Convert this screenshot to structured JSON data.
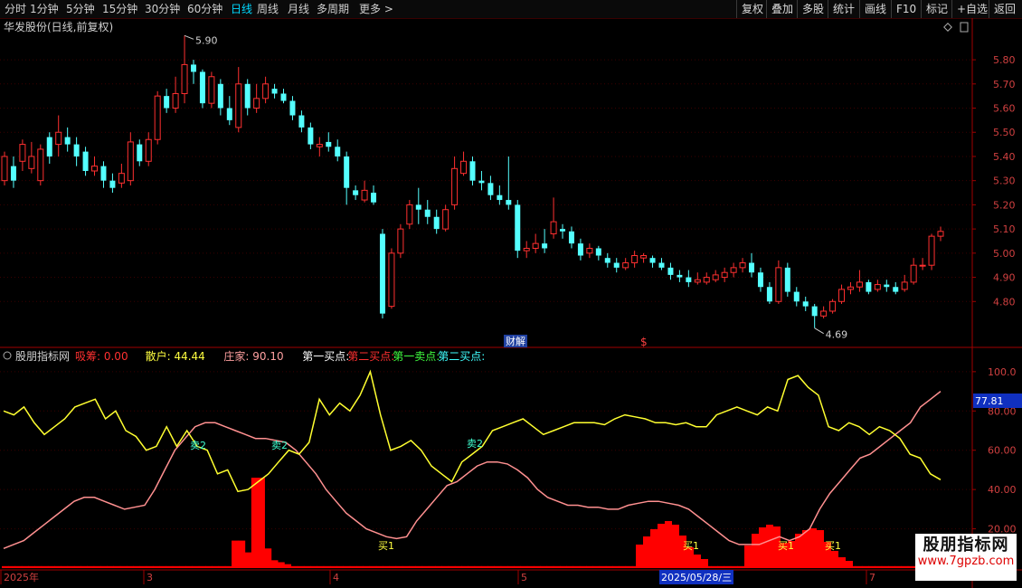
{
  "toolbar": {
    "timeframes": [
      {
        "label": "分时",
        "x": 5
      },
      {
        "label": "1分钟",
        "x": 33
      },
      {
        "label": "5分钟",
        "x": 73
      },
      {
        "label": "15分钟",
        "x": 113
      },
      {
        "label": "30分钟",
        "x": 160
      },
      {
        "label": "60分钟",
        "x": 207
      },
      {
        "label": "日线",
        "x": 255,
        "active": true
      },
      {
        "label": "周线",
        "x": 284
      },
      {
        "label": "月线",
        "x": 318
      },
      {
        "label": "多周期",
        "x": 350
      },
      {
        "label": "更多",
        "x": 397
      }
    ],
    "more_arrow": ">",
    "right_buttons": [
      {
        "label": "复权",
        "x": 814
      },
      {
        "label": "叠加",
        "x": 847
      },
      {
        "label": "多股",
        "x": 881
      },
      {
        "label": "统计",
        "x": 915
      },
      {
        "label": "画线",
        "x": 950
      },
      {
        "label": "F10",
        "x": 985
      },
      {
        "label": "标记",
        "x": 1018
      },
      {
        "label": "+自选",
        "x": 1052
      },
      {
        "label": "返回",
        "x": 1093
      }
    ]
  },
  "main_panel": {
    "title": "华发股份(日线,前复权)",
    "high_label": "5.90",
    "low_label": "4.69",
    "markers": {
      "caijie": "财解",
      "dollar": "$"
    },
    "y_ticks": [
      "5.80",
      "5.70",
      "5.60",
      "5.50",
      "5.40",
      "5.30",
      "5.20",
      "5.10",
      "5.00",
      "4.90",
      "4.80"
    ]
  },
  "indicator_panel": {
    "name": "股朋指标网",
    "legend": [
      {
        "label": "吸筹:",
        "value": "0.00",
        "color": "#ff3030"
      },
      {
        "label": "散户:",
        "value": "44.44",
        "color": "#ffff40"
      },
      {
        "label": "庄家:",
        "value": "90.10",
        "color": "#ffa0a0"
      },
      {
        "label": "第一买点:",
        "value": "",
        "color": "#ffffff"
      },
      {
        "label": "第二买点:",
        "value": "",
        "color": "#ff3030"
      },
      {
        "label": "第一卖点:",
        "value": "",
        "color": "#40ff40"
      },
      {
        "label": "第二买点:",
        "value": "",
        "color": "#40ffff"
      }
    ],
    "y_ticks": [
      "100.0",
      "80.00",
      "60.00",
      "40.00",
      "20.00"
    ],
    "current_value": "77.81",
    "sell_labels": [
      "卖2",
      "卖2",
      "卖2"
    ],
    "buy_labels": [
      "买1",
      "买1",
      "买1",
      "买1"
    ]
  },
  "x_axis": {
    "labels": [
      "2025年",
      "3",
      "4",
      "5",
      "2025/05/28/三",
      "7"
    ]
  },
  "watermark": {
    "title": "股朋指标网",
    "url": "www.7gpzb.com"
  },
  "colors": {
    "up": "#ff3030",
    "down": "#54ffff",
    "retail": "#ffff30",
    "banker": "#ff9090",
    "accum": "#ff0000"
  },
  "chart_data": [
    {
      "type": "candlestick",
      "title": "华发股份(日线,前复权)",
      "x": "trading days 2025-02 to 2025-07",
      "candles": [
        [
          5.3,
          5.4,
          5.42,
          5.28
        ],
        [
          5.36,
          5.3,
          5.4,
          5.27
        ],
        [
          5.38,
          5.45,
          5.47,
          5.34
        ],
        [
          5.35,
          5.4,
          5.46,
          5.33
        ],
        [
          5.3,
          5.43,
          5.45,
          5.28
        ],
        [
          5.48,
          5.4,
          5.5,
          5.37
        ],
        [
          5.45,
          5.5,
          5.57,
          5.4
        ],
        [
          5.48,
          5.45,
          5.52,
          5.42
        ],
        [
          5.45,
          5.4,
          5.48,
          5.36
        ],
        [
          5.42,
          5.34,
          5.44,
          5.32
        ],
        [
          5.34,
          5.36,
          5.4,
          5.32
        ],
        [
          5.36,
          5.3,
          5.38,
          5.27
        ],
        [
          5.3,
          5.27,
          5.33,
          5.25
        ],
        [
          5.29,
          5.33,
          5.37,
          5.27
        ],
        [
          5.3,
          5.46,
          5.5,
          5.28
        ],
        [
          5.45,
          5.38,
          5.47,
          5.36
        ],
        [
          5.38,
          5.47,
          5.5,
          5.36
        ],
        [
          5.47,
          5.65,
          5.67,
          5.45
        ],
        [
          5.65,
          5.6,
          5.68,
          5.58
        ],
        [
          5.6,
          5.66,
          5.73,
          5.58
        ],
        [
          5.66,
          5.78,
          5.9,
          5.62
        ],
        [
          5.78,
          5.75,
          5.8,
          5.7
        ],
        [
          5.75,
          5.62,
          5.76,
          5.6
        ],
        [
          5.62,
          5.73,
          5.75,
          5.6
        ],
        [
          5.7,
          5.6,
          5.72,
          5.57
        ],
        [
          5.6,
          5.55,
          5.65,
          5.53
        ],
        [
          5.52,
          5.7,
          5.77,
          5.5
        ],
        [
          5.7,
          5.6,
          5.72,
          5.57
        ],
        [
          5.6,
          5.64,
          5.7,
          5.58
        ],
        [
          5.64,
          5.7,
          5.73,
          5.62
        ],
        [
          5.68,
          5.66,
          5.7,
          5.64
        ],
        [
          5.66,
          5.63,
          5.68,
          5.62
        ],
        [
          5.63,
          5.57,
          5.65,
          5.55
        ],
        [
          5.57,
          5.52,
          5.59,
          5.5
        ],
        [
          5.52,
          5.45,
          5.54,
          5.43
        ],
        [
          5.44,
          5.45,
          5.48,
          5.4
        ],
        [
          5.46,
          5.44,
          5.5,
          5.42
        ],
        [
          5.44,
          5.4,
          5.47,
          5.38
        ],
        [
          5.4,
          5.27,
          5.42,
          5.2
        ],
        [
          5.26,
          5.24,
          5.28,
          5.22
        ],
        [
          5.22,
          5.26,
          5.3,
          5.21
        ],
        [
          5.25,
          5.21,
          5.28,
          5.2
        ],
        [
          5.08,
          4.75,
          5.1,
          4.73
        ],
        [
          4.78,
          5.0,
          5.02,
          4.77
        ],
        [
          5.0,
          5.1,
          5.12,
          4.98
        ],
        [
          5.12,
          5.2,
          5.22,
          5.1
        ],
        [
          5.2,
          5.18,
          5.27,
          5.12
        ],
        [
          5.18,
          5.15,
          5.22,
          5.12
        ],
        [
          5.15,
          5.1,
          5.18,
          5.08
        ],
        [
          5.1,
          5.18,
          5.2,
          5.09
        ],
        [
          5.2,
          5.35,
          5.4,
          5.18
        ],
        [
          5.33,
          5.38,
          5.42,
          5.32
        ],
        [
          5.38,
          5.3,
          5.4,
          5.28
        ],
        [
          5.3,
          5.29,
          5.34,
          5.26
        ],
        [
          5.29,
          5.24,
          5.32,
          5.22
        ],
        [
          5.24,
          5.22,
          5.28,
          5.2
        ],
        [
          5.22,
          5.2,
          5.4,
          5.18
        ],
        [
          5.2,
          5.01,
          5.22,
          4.98
        ],
        [
          5.01,
          5.02,
          5.05,
          4.98
        ],
        [
          5.02,
          5.04,
          5.08,
          5.0
        ],
        [
          5.04,
          5.02,
          5.1,
          5.0
        ],
        [
          5.08,
          5.13,
          5.23,
          5.06
        ],
        [
          5.1,
          5.09,
          5.12,
          5.06
        ],
        [
          5.09,
          5.04,
          5.11,
          5.02
        ],
        [
          5.04,
          4.99,
          5.06,
          4.97
        ],
        [
          5.0,
          5.02,
          5.04,
          4.98
        ],
        [
          5.02,
          4.99,
          5.03,
          4.97
        ],
        [
          4.98,
          4.96,
          5.0,
          4.94
        ],
        [
          4.96,
          4.94,
          4.98,
          4.92
        ],
        [
          4.94,
          4.96,
          4.98,
          4.93
        ],
        [
          4.96,
          4.99,
          5.01,
          4.94
        ],
        [
          4.98,
          4.99,
          5.0,
          4.96
        ],
        [
          4.98,
          4.96,
          4.99,
          4.94
        ],
        [
          4.96,
          4.94,
          4.98,
          4.93
        ],
        [
          4.94,
          4.91,
          4.96,
          4.89
        ],
        [
          4.91,
          4.9,
          4.93,
          4.88
        ],
        [
          4.9,
          4.88,
          4.93,
          4.86
        ],
        [
          4.88,
          4.89,
          4.92,
          4.87
        ],
        [
          4.88,
          4.9,
          4.92,
          4.87
        ],
        [
          4.89,
          4.91,
          4.93,
          4.88
        ],
        [
          4.9,
          4.92,
          4.94,
          4.88
        ],
        [
          4.92,
          4.94,
          4.96,
          4.9
        ],
        [
          4.94,
          4.96,
          4.98,
          4.92
        ],
        [
          4.96,
          4.92,
          5.0,
          4.9
        ],
        [
          4.92,
          4.86,
          4.94,
          4.84
        ],
        [
          4.86,
          4.8,
          4.88,
          4.79
        ],
        [
          4.8,
          4.94,
          4.97,
          4.79
        ],
        [
          4.94,
          4.84,
          4.96,
          4.82
        ],
        [
          4.84,
          4.8,
          4.86,
          4.78
        ],
        [
          4.8,
          4.78,
          4.82,
          4.76
        ],
        [
          4.78,
          4.74,
          4.79,
          4.69
        ],
        [
          4.74,
          4.76,
          4.78,
          4.73
        ],
        [
          4.76,
          4.8,
          4.81,
          4.75
        ],
        [
          4.8,
          4.85,
          4.87,
          4.79
        ],
        [
          4.85,
          4.86,
          4.88,
          4.83
        ],
        [
          4.86,
          4.88,
          4.93,
          4.84
        ],
        [
          4.88,
          4.84,
          4.89,
          4.83
        ],
        [
          4.85,
          4.87,
          4.89,
          4.84
        ],
        [
          4.87,
          4.86,
          4.89,
          4.84
        ],
        [
          4.86,
          4.84,
          4.88,
          4.83
        ],
        [
          4.85,
          4.88,
          4.91,
          4.84
        ],
        [
          4.88,
          4.95,
          4.98,
          4.87
        ],
        [
          4.95,
          4.95,
          4.98,
          4.93
        ],
        [
          4.95,
          5.07,
          5.08,
          4.93
        ],
        [
          5.07,
          5.09,
          5.11,
          5.05
        ]
      ],
      "ylim": [
        4.7,
        5.92
      ]
    },
    {
      "type": "line+bar",
      "series": [
        {
          "name": "散户",
          "values": [
            80,
            78,
            82,
            74,
            68,
            72,
            76,
            82,
            84,
            86,
            76,
            80,
            70,
            67,
            60,
            62,
            72,
            62,
            70,
            62,
            60,
            48,
            50,
            39,
            40,
            44,
            48,
            54,
            60,
            58,
            64,
            86,
            78,
            84,
            80,
            88,
            100,
            78,
            60,
            62,
            65,
            60,
            52,
            48,
            44,
            54,
            58,
            62,
            70,
            72,
            74,
            76,
            72,
            68,
            70,
            72,
            74,
            74,
            74,
            73,
            76,
            78,
            77,
            76,
            74,
            74,
            73,
            74,
            72,
            72,
            78,
            80,
            82,
            80,
            78,
            82,
            80,
            96,
            98,
            92,
            88,
            72,
            70,
            74,
            72,
            68,
            72,
            70,
            66,
            58,
            56,
            48,
            45
          ]
        },
        {
          "name": "庄家",
          "values": [
            10,
            12,
            14,
            18,
            22,
            26,
            30,
            34,
            36,
            36,
            34,
            32,
            30,
            31,
            32,
            40,
            50,
            60,
            66,
            72,
            74,
            74,
            72,
            70,
            68,
            66,
            66,
            65,
            64,
            60,
            54,
            48,
            40,
            34,
            28,
            24,
            20,
            18,
            16,
            15,
            16,
            24,
            30,
            36,
            42,
            44,
            48,
            52,
            54,
            54,
            53,
            50,
            46,
            40,
            36,
            34,
            32,
            32,
            31,
            31,
            30,
            30,
            32,
            33,
            34,
            34,
            33,
            32,
            30,
            26,
            22,
            18,
            14,
            12,
            12,
            12,
            14,
            16,
            14,
            16,
            20,
            30,
            38,
            44,
            50,
            56,
            58,
            62,
            66,
            70,
            74,
            82,
            86,
            90
          ]
        },
        {
          "name": "吸筹",
          "values": [
            1,
            1,
            1,
            1,
            1,
            1,
            1,
            1,
            1,
            1,
            1,
            1,
            1,
            1,
            1,
            1,
            1,
            1,
            1,
            1,
            1,
            1,
            1,
            1,
            1,
            1,
            1,
            1,
            1,
            1,
            1,
            1,
            1,
            1,
            1,
            14,
            14,
            8,
            46,
            46,
            10,
            4,
            3,
            2,
            1,
            1,
            1,
            1,
            1,
            1,
            1,
            1,
            1,
            1,
            1,
            1,
            1,
            1,
            1,
            1,
            1,
            1,
            1,
            1,
            1,
            1,
            1,
            1,
            1,
            1,
            1,
            1,
            1,
            1,
            1,
            1,
            1,
            1,
            1,
            1,
            1,
            1,
            1,
            1,
            1,
            1,
            1,
            1,
            1,
            1,
            1,
            1,
            1,
            1,
            1,
            1,
            1,
            1,
            1,
            1,
            1,
            1,
            1,
            1,
            1,
            1,
            1,
            1,
            1,
            1,
            1,
            1,
            1,
            1,
            1,
            1,
            1,
            1,
            1,
            1,
            1,
            1,
            1,
            1,
            1,
            1,
            1,
            1,
            1,
            1,
            1,
            1,
            1,
            1,
            1,
            1,
            1,
            1,
            1,
            1,
            1,
            1,
            1,
            1
          ]
        }
      ],
      "ylim": [
        0,
        105
      ]
    }
  ]
}
